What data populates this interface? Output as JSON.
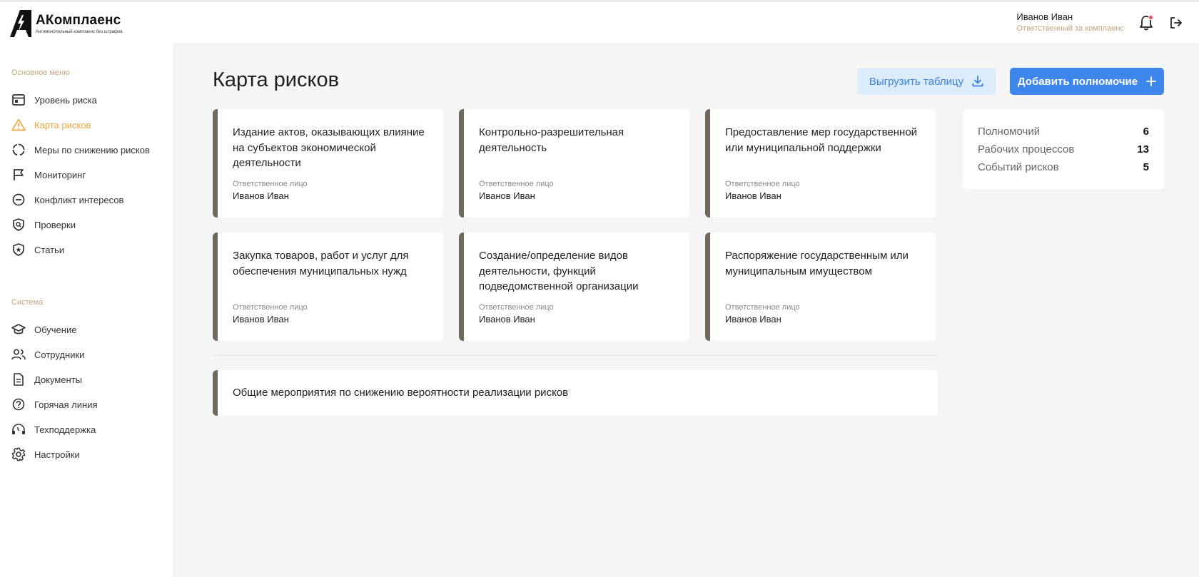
{
  "app": {
    "name": "АКомплаенс",
    "tagline": "Антимонопольный комплаенс без штрафов"
  },
  "user": {
    "name": "Иванов Иван",
    "role": "Ответственный за комплаенс"
  },
  "sidebar": {
    "main_title": "Основное меню",
    "main_items": [
      {
        "label": "Уровень риска",
        "icon": "dashboard-icon"
      },
      {
        "label": "Карта рисков",
        "icon": "warning-icon",
        "active": true
      },
      {
        "label": "Меры по снижению рисков",
        "icon": "cycle-icon"
      },
      {
        "label": "Мониторинг",
        "icon": "flag-icon"
      },
      {
        "label": "Конфликт интересов",
        "icon": "minus-circle-icon"
      },
      {
        "label": "Проверки",
        "icon": "shield-search-icon"
      },
      {
        "label": "Статьи",
        "icon": "shield-star-icon"
      }
    ],
    "system_title": "Система",
    "system_items": [
      {
        "label": "Обучение",
        "icon": "graduation-cap-icon"
      },
      {
        "label": "Сотрудники",
        "icon": "users-icon"
      },
      {
        "label": "Документы",
        "icon": "document-icon"
      },
      {
        "label": "Горячая линия",
        "icon": "question-icon"
      },
      {
        "label": "Техподдержка",
        "icon": "headset-icon"
      },
      {
        "label": "Настройки",
        "icon": "gear-icon"
      }
    ]
  },
  "page": {
    "title": "Карта рисков",
    "export_label": "Выгрузить таблицу",
    "add_label": "Добавить полномочие"
  },
  "cards": [
    {
      "title": "Издание актов, оказывающих влияние на субъектов экономической деятельности",
      "label": "Ответственное лицо",
      "person": "Иванов Иван"
    },
    {
      "title": "Контрольно-разрешительная деятельность",
      "label": "Ответственное лицо",
      "person": "Иванов Иван"
    },
    {
      "title": "Предоставление мер государственной или муниципальной поддержки",
      "label": "Ответственное лицо",
      "person": "Иванов Иван"
    },
    {
      "title": "Закупка товаров, работ и услуг для обеспечения муниципальных нужд",
      "label": "Ответственное лицо",
      "person": "Иванов Иван"
    },
    {
      "title": "Создание/определение видов деятельности, функций подведомственной организации",
      "label": "Ответственное лицо",
      "person": "Иванов Иван"
    },
    {
      "title": "Распоряжение государственным или муниципальным имуществом",
      "label": "Ответственное лицо",
      "person": "Иванов Иван"
    }
  ],
  "general": {
    "text": "Общие мероприятия по снижению вероятности реализации рисков"
  },
  "stats": [
    {
      "label": "Полномочий",
      "value": "6"
    },
    {
      "label": "Рабочих процессов",
      "value": "13"
    },
    {
      "label": "Событий рисков",
      "value": "5"
    }
  ],
  "colors": {
    "accent": "#3e86ec",
    "accent_light": "#dcecfb",
    "active_nav": "#f2a43a",
    "card_border": "#6f695d",
    "notification": "#ea4e5c"
  }
}
